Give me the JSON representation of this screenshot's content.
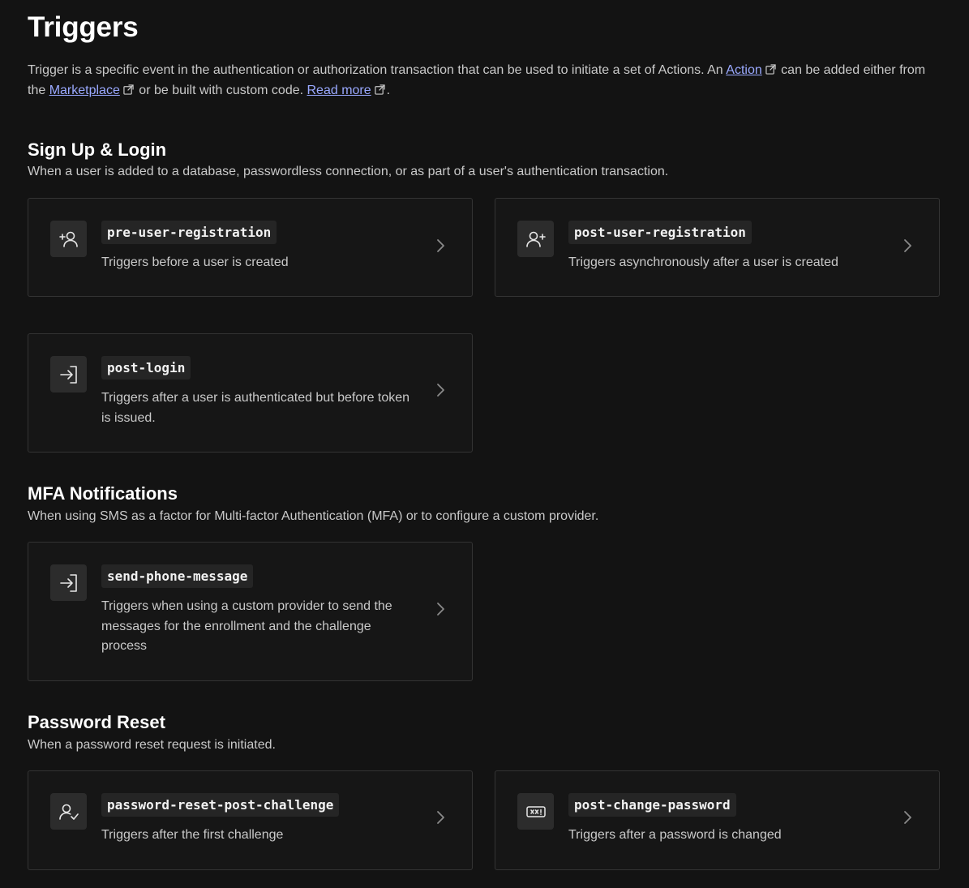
{
  "page": {
    "title": "Triggers",
    "intro": {
      "text_1": "Trigger is a specific event in the authentication or authorization transaction that can be used to initiate a set of Actions. An ",
      "link_action": "Action",
      "text_2": " can be added either from the ",
      "link_marketplace": "Marketplace",
      "text_3": " or be built with custom code. ",
      "link_read_more": "Read more",
      "text_4": "."
    }
  },
  "sections": {
    "signup_login": {
      "title": "Sign Up & Login",
      "description": "When a user is added to a database, passwordless connection, or as part of a user's authentication transaction.",
      "cards": [
        {
          "name": "pre-user-registration",
          "description": "Triggers before a user is created",
          "icon": "user-add-icon"
        },
        {
          "name": "post-user-registration",
          "description": "Triggers asynchronously after a user is created",
          "icon": "user-plus-icon"
        },
        {
          "name": "post-login",
          "description": "Triggers after a user is authenticated but before token is issued.",
          "icon": "login-icon"
        }
      ]
    },
    "mfa": {
      "title": "MFA Notifications",
      "description": "When using SMS as a factor for Multi-factor Authentication (MFA) or to configure a custom provider.",
      "cards": [
        {
          "name": "send-phone-message",
          "description": "Triggers when using a custom provider to send the messages for the enrollment and the challenge process",
          "icon": "login-icon"
        }
      ]
    },
    "password_reset": {
      "title": "Password Reset",
      "description": "When a password reset request is initiated.",
      "cards": [
        {
          "name": "password-reset-post-challenge",
          "description": "Triggers after the first challenge",
          "icon": "user-check-icon"
        },
        {
          "name": "post-change-password",
          "description": "Triggers after a password is changed",
          "icon": "password-field-icon"
        }
      ]
    }
  },
  "colors": {
    "background": "#131313",
    "card_background": "#161616",
    "card_border": "#333333",
    "link": "#9aa9ff"
  }
}
